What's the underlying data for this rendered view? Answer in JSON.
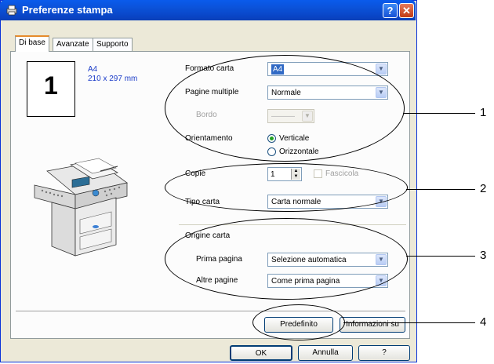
{
  "window": {
    "title": "Preferenze stampa",
    "help_button": "?",
    "close_button": "✕"
  },
  "tabs": [
    {
      "label": "Di base",
      "selected": true
    },
    {
      "label": "Avanzate",
      "selected": false
    },
    {
      "label": "Supporto",
      "selected": false
    }
  ],
  "preview": {
    "page_number": "1",
    "paper_size": "A4",
    "paper_dimensions": "210 x 297 mm"
  },
  "paper_group": {
    "paper_size_label": "Formato carta",
    "paper_size_value": "A4",
    "multiple_pages_label": "Pagine multiple",
    "multiple_pages_value": "Normale",
    "border_label": "Bordo",
    "border_value": "———",
    "orientation_label": "Orientamento",
    "orientation_options": [
      "Verticale",
      "Orizzontale"
    ],
    "orientation_selected": "Verticale"
  },
  "copies_group": {
    "copies_label": "Copie",
    "copies_value": "1",
    "collate_label": "Fascicola",
    "media_type_label": "Tipo carta",
    "media_type_value": "Carta normale"
  },
  "source_group": {
    "title": "Origine carta",
    "first_page_label": "Prima pagina",
    "first_page_value": "Selezione automatica",
    "other_pages_label": "Altre pagine",
    "other_pages_value": "Come prima pagina"
  },
  "buttons": {
    "default": "Predefinito",
    "info": "Informazioni su",
    "ok": "OK",
    "cancel": "Annulla",
    "help": "?"
  },
  "callouts": [
    "1",
    "2",
    "3",
    "4"
  ]
}
